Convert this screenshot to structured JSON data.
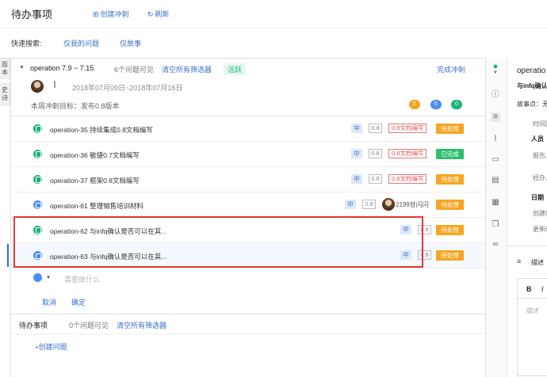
{
  "header": {
    "title": "待办事项",
    "create_sprint": "创建冲刺",
    "refresh": "刷新"
  },
  "quick_search": {
    "label": "快速搜索:",
    "only_my_issues": "仅我的问题",
    "only_stories": "仅故事"
  },
  "left_tabs": {
    "version": "版本",
    "epic": "史诗"
  },
  "sprint": {
    "name": "operation 7.9 ~ 7.15",
    "issue_count": "6个问题可见",
    "clear_filters": "清空所有筛选器",
    "status": "活跃",
    "complete": "完成冲刺",
    "date_range": "2018年07月09日~2018年07月16日",
    "goal": "本周冲刺目标：发布0.8版本",
    "counters": [
      {
        "value": "0",
        "color": "#f5a623"
      },
      {
        "value": "0",
        "color": "#4c8df6"
      },
      {
        "value": "0",
        "color": "#1bb37a"
      }
    ]
  },
  "issues": [
    {
      "type": "story",
      "key": "operation-35",
      "summary": "持续集成0.8文档编写",
      "priority": "中",
      "estimate": "0.8",
      "version": "0.8文档编写",
      "status": "待处理",
      "status_color": "orange"
    },
    {
      "type": "story",
      "key": "operation-36",
      "summary": "敏捷0.7文档编写",
      "priority": "中",
      "estimate": "0.8",
      "version": "0.8文档编写",
      "status": "已完成",
      "status_color": "green"
    },
    {
      "type": "story",
      "key": "operation-37",
      "summary": "框架0.8文档编写",
      "priority": "中",
      "estimate": "0.8",
      "version": "0.8文档编写",
      "status": "待处理",
      "status_color": "orange"
    },
    {
      "type": "task",
      "key": "operation-61",
      "summary": "整理销售培训材料",
      "priority": "中",
      "estimate": "0.8",
      "assignee": "2199甘闪闪",
      "status": "待处理",
      "status_color": "orange"
    },
    {
      "type": "story",
      "key": "operation-62",
      "summary": "与infq确认是否可以在其...",
      "priority": "中",
      "estimate": "0.8",
      "status": "待处理",
      "status_color": "orange"
    },
    {
      "type": "task",
      "key": "operation-63",
      "summary": "与infq确认是否可以在其...",
      "priority": "中",
      "estimate": "0.8",
      "status": "待处理",
      "status_color": "orange"
    }
  ],
  "new_issue": {
    "placeholder": "需要做什么",
    "cancel": "取消",
    "confirm": "确定"
  },
  "backlog": {
    "title": "待办事项",
    "count": "0个问题可见",
    "clear_filters": "清空所有筛选器",
    "create_issue": "创建问题"
  },
  "right_panel": {
    "title": "operatio",
    "subtitle": "与infq确认",
    "story_points": "故事点：无",
    "time": "时间跟",
    "people": "人员",
    "reporter": "报告人",
    "handler": "经办人",
    "date": "日期",
    "created": "创建时",
    "updated": "更新时",
    "description": "描述",
    "bold_btn": "B",
    "italic_btn": "I",
    "desc_placeholder": "描述"
  }
}
